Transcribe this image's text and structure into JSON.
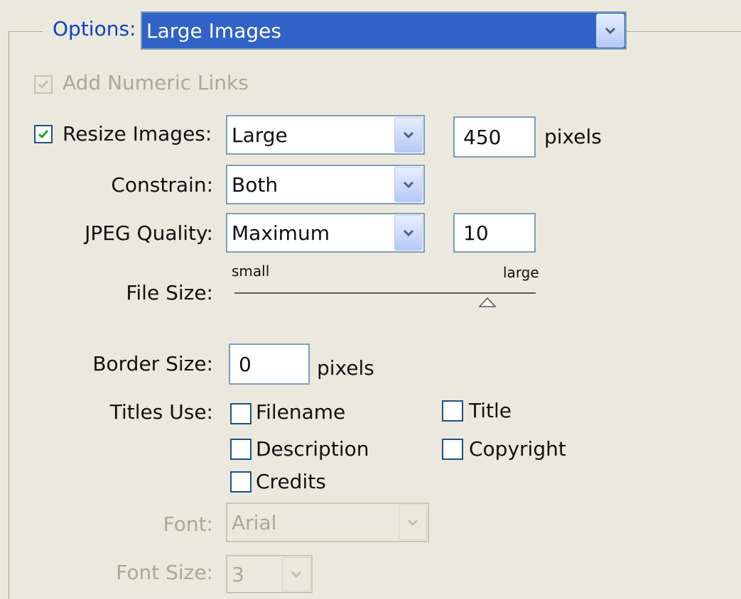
{
  "options": {
    "legend": "Options:",
    "value": "Large Images"
  },
  "add_numeric_links": {
    "label": "Add Numeric Links",
    "checked": true,
    "disabled": true
  },
  "resize_images": {
    "label": "Resize Images:",
    "checked": true,
    "size_value": "Large",
    "pixels_value": "450",
    "unit": "pixels"
  },
  "constrain": {
    "label": "Constrain:",
    "value": "Both"
  },
  "jpeg_quality": {
    "label": "JPEG Quality:",
    "value": "Maximum",
    "number": "10"
  },
  "file_size": {
    "label": "File Size:",
    "min_label": "small",
    "max_label": "large",
    "level": 0.84
  },
  "border_size": {
    "label": "Border Size:",
    "value": "0",
    "unit": "pixels"
  },
  "titles_use": {
    "label": "Titles Use:",
    "options": [
      {
        "label": "Filename",
        "checked": false
      },
      {
        "label": "Title",
        "checked": false
      },
      {
        "label": "Description",
        "checked": false
      },
      {
        "label": "Copyright",
        "checked": false
      },
      {
        "label": "Credits",
        "checked": false
      }
    ]
  },
  "font": {
    "label": "Font:",
    "value": "Arial",
    "disabled": true
  },
  "font_size": {
    "label": "Font Size:",
    "value": "3",
    "disabled": true
  },
  "colors": {
    "accent_blue": "#3162c8",
    "legend_blue": "#1040c8",
    "check_green": "#21a121",
    "disabled_text": "#aca899"
  }
}
